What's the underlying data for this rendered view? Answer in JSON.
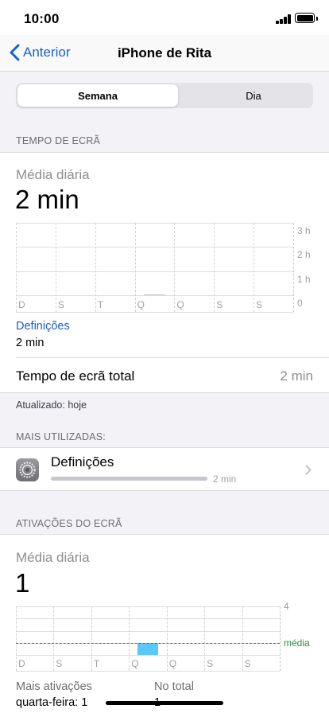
{
  "status": {
    "time": "10:00"
  },
  "nav": {
    "back_label": "Anterior",
    "title": "iPhone de Rita"
  },
  "segments": {
    "week": "Semana",
    "day": "Dia"
  },
  "screen_time": {
    "header": "TEMPO DE ECRÃ",
    "avg_label": "Média diária",
    "avg_value": "2 min",
    "category_link": "Definições",
    "category_value": "2 min",
    "total_label": "Tempo de ecrã total",
    "total_value": "2 min",
    "updated": "Atualizado: hoje"
  },
  "most_used": {
    "header": "MAIS UTILIZADAS:",
    "app_name": "Definições",
    "app_time": "2 min",
    "icon": "settings-gear-icon"
  },
  "pickups": {
    "header": "ATIVAÇÕES DO ECRÃ",
    "avg_label": "Média diária",
    "avg_value": "1",
    "most_label": "Mais ativações",
    "most_value": "quarta-feira: 1",
    "total_label": "No total",
    "total_value": "1"
  },
  "chart_data": [
    {
      "type": "bar",
      "categories": [
        "D",
        "S",
        "T",
        "Q",
        "Q",
        "S",
        "S"
      ],
      "values": [
        0,
        0,
        0,
        0.03,
        0,
        0,
        0
      ],
      "y_ticks": [
        "3 h",
        "2 h",
        "1 h",
        "0"
      ],
      "ylim": [
        0,
        3
      ],
      "unit": "h",
      "color": "#c7c7cc"
    },
    {
      "type": "bar",
      "categories": [
        "D",
        "S",
        "T",
        "Q",
        "Q",
        "S",
        "S"
      ],
      "values": [
        0,
        0,
        0,
        1,
        0,
        0,
        0
      ],
      "y_ticks": [
        "4"
      ],
      "ylim": [
        0,
        4
      ],
      "average": 1,
      "average_label": "média",
      "color": "#5ac8fa",
      "average_color": "#34a853"
    }
  ],
  "colors": {
    "accent": "#1a5fd0",
    "pickup_bar": "#5ac8fa",
    "average_line": "#2e8b3a"
  }
}
